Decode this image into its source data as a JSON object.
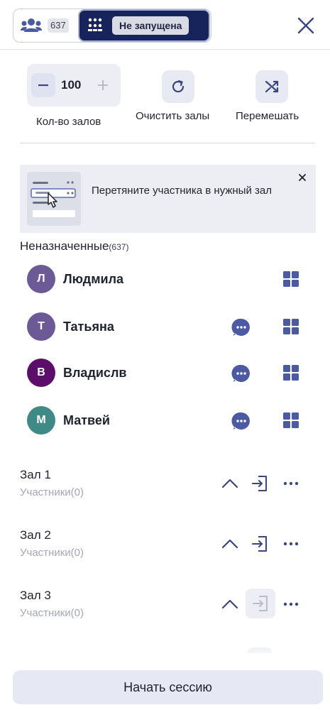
{
  "header": {
    "participants_count": "637",
    "status_label": "Не запущена"
  },
  "controls": {
    "halls_value": "100",
    "halls_label": "Кол-во залов",
    "clear_label": "Очистить залы",
    "shuffle_label": "Перемешать"
  },
  "hint": {
    "text": "Перетяните участника в нужный зал"
  },
  "unassigned": {
    "title": "Неназначенные",
    "count": "(637)"
  },
  "participants": [
    {
      "initial": "Л",
      "name": "Людмила",
      "color": "#6b5a96",
      "chat": false
    },
    {
      "initial": "Т",
      "name": "Татьяна",
      "color": "#6b5a96",
      "chat": true
    },
    {
      "initial": "В",
      "name": "Владислв",
      "color": "#5b0f6b",
      "chat": true
    },
    {
      "initial": "М",
      "name": "Матвей",
      "color": "#3f8a86",
      "chat": true
    }
  ],
  "rooms": [
    {
      "name": "Зал 1",
      "subtitle": "Участники(0)",
      "enter_disabled": false
    },
    {
      "name": "Зал 2",
      "subtitle": "Участники(0)",
      "enter_disabled": false
    },
    {
      "name": "Зал 3",
      "subtitle": "Участники(0)",
      "enter_disabled": true
    }
  ],
  "footer": {
    "start_label": "Начать сессию"
  },
  "colors": {
    "accent": "#4b5aa3",
    "navy": "#17245c"
  }
}
